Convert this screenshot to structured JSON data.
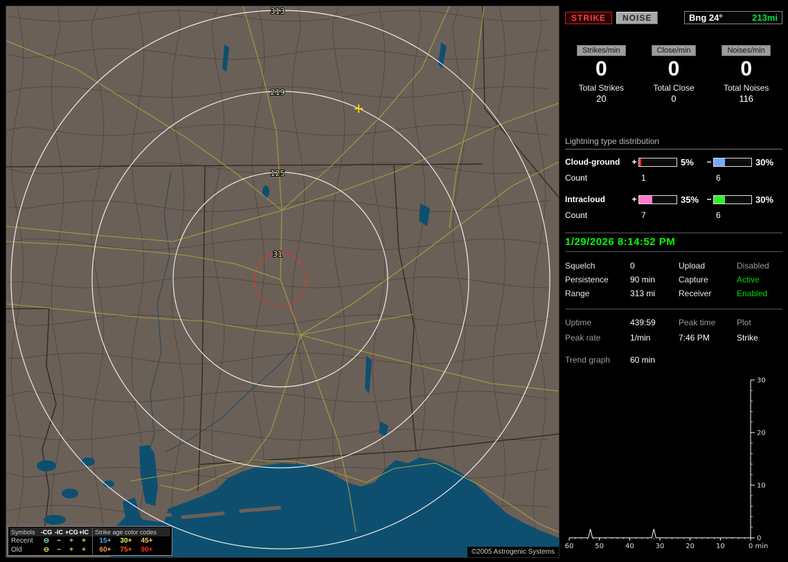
{
  "map": {
    "rings": [
      {
        "label": "313",
        "miles": 313
      },
      {
        "label": "219",
        "miles": 219
      },
      {
        "label": "125",
        "miles": 125
      },
      {
        "label": "31",
        "miles": 31
      }
    ],
    "strike_marker": {
      "symbol": "+",
      "color": "#ffd700"
    },
    "copyright": "©2005 Astrogenic Systems",
    "legend": {
      "symbols_title": "Symbols",
      "symbol_headers": [
        "-CG",
        "-IC",
        "+CG",
        "+IC"
      ],
      "age_title": "Strike age color codes",
      "rows": [
        {
          "label": "Recent",
          "symbols": [
            {
              "glyph": "⊖",
              "color": "#7fe0a8"
            },
            {
              "glyph": "−",
              "color": "#e8e868"
            },
            {
              "glyph": "+",
              "color": "#7fe0a8"
            },
            {
              "glyph": "+",
              "color": "#e8e868"
            }
          ],
          "ages": [
            {
              "text": "15+",
              "color": "#55aaff"
            },
            {
              "text": "30+",
              "color": "#eded55"
            },
            {
              "text": "45+",
              "color": "#ffd24a"
            }
          ]
        },
        {
          "label": "Old",
          "symbols": [
            {
              "glyph": "⊖",
              "color": "#d8d855"
            },
            {
              "glyph": "−",
              "color": "#d8d855"
            },
            {
              "glyph": "+",
              "color": "#d8d855"
            },
            {
              "glyph": "+",
              "color": "#d8d855"
            }
          ],
          "ages": [
            {
              "text": "60+",
              "color": "#ff9933"
            },
            {
              "text": "75+",
              "color": "#ff5522"
            },
            {
              "text": "90+",
              "color": "#ff2222"
            }
          ]
        }
      ]
    }
  },
  "panel": {
    "strike_button": "STRIKE",
    "noise_button": "NOISE",
    "bearing_label": "Bng 24°",
    "distance_label": "213mi",
    "accent_green": "#00ff00",
    "rates": [
      {
        "label": "Strikes/min",
        "value": "0",
        "total_label": "Total Strikes",
        "total_value": "20"
      },
      {
        "label": "Close/min",
        "value": "0",
        "total_label": "Total Close",
        "total_value": "0"
      },
      {
        "label": "Noises/min",
        "value": "0",
        "total_label": "Total Noises",
        "total_value": "116"
      }
    ],
    "distribution": {
      "title": "Lightning type distribution",
      "rows": [
        {
          "label": "Cloud-ground",
          "plus_sign": "+",
          "plus_pct": 5,
          "plus_pct_label": "5%",
          "plus_color": "#ff2222",
          "minus_sign": "−",
          "minus_pct": 30,
          "minus_pct_label": "30%",
          "minus_color": "#77aaff",
          "count_label": "Count",
          "plus_count": "1",
          "minus_count": "6"
        },
        {
          "label": "Intracloud",
          "plus_sign": "+",
          "plus_pct": 35,
          "plus_pct_label": "35%",
          "plus_color": "#ff77cc",
          "minus_sign": "−",
          "minus_pct": 30,
          "minus_pct_label": "30%",
          "minus_color": "#33ee33",
          "count_label": "Count",
          "plus_count": "7",
          "minus_count": "6"
        }
      ]
    },
    "datetime": "1/29/2026 8:14:52 PM",
    "settings": {
      "squelch_label": "Squelch",
      "squelch_value": "0",
      "upload_label": "Upload",
      "upload_value": "Disabled",
      "persistence_label": "Persistence",
      "persistence_value": "90 min",
      "capture_label": "Capture",
      "capture_value": "Active",
      "range_label": "Range",
      "range_value": "313 mi",
      "receiver_label": "Receiver",
      "receiver_value": "Enabled"
    },
    "stats": {
      "uptime_label": "Uptime",
      "uptime_value": "439:59",
      "peak_time_label": "Peak time",
      "plot_label": "Plot",
      "peak_rate_label": "Peak rate",
      "peak_rate_value": "1/min",
      "peak_time_value": "7:46 PM",
      "plot_value": "Strike",
      "trend_label": "Trend graph",
      "trend_value": "60 min"
    }
  },
  "chart_data": {
    "type": "line",
    "title": "Trend graph",
    "window_label": "60 min",
    "xlabel": "min",
    "x_ticks": [
      60,
      50,
      40,
      30,
      20,
      10,
      0
    ],
    "y_ticks": [
      30,
      20,
      10,
      0
    ],
    "ylim": [
      0,
      30
    ],
    "xlim_minutes_ago": [
      60,
      0
    ],
    "legend_position": "none",
    "grid": false,
    "series": [
      {
        "name": "Strikes/min",
        "color": "#ffffff",
        "baseline": 0,
        "points_minutes_ago": [
          {
            "x": 53,
            "y": 1
          },
          {
            "x": 32,
            "y": 1
          }
        ]
      }
    ]
  }
}
